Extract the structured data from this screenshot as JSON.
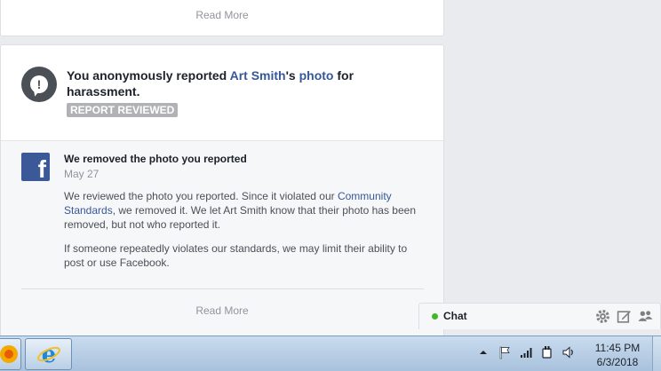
{
  "top_card": {
    "read_more": "Read More"
  },
  "report": {
    "prefix": "You anonymously reported ",
    "person": "Art Smith",
    "possessive": "'s ",
    "object": "photo",
    "suffix": " for harassment.",
    "badge": "REPORT REVIEWED"
  },
  "message": {
    "title": "We removed the photo you reported",
    "date": "May 27",
    "p1_before": "We reviewed the photo you reported. Since it violated our ",
    "p1_link": "Community Standards",
    "p1_after": ", we removed it. We let Art Smith know that their photo has been removed, but not who reported it.",
    "p2": "If someone repeatedly violates our standards, we may limit their ability to post or use Facebook.",
    "read_more": "Read More"
  },
  "chat": {
    "label": "Chat",
    "icons": [
      "gear-icon",
      "compose-icon",
      "friends-icon"
    ],
    "status_color": "#42b72a"
  },
  "taskbar": {
    "time": "11:45 PM",
    "date": "6/3/2018",
    "tray_icons": [
      "up-arrow-icon",
      "flag-icon",
      "signal-icon",
      "power-icon",
      "volume-icon"
    ]
  },
  "colors": {
    "link": "#365899",
    "fb_blue": "#3b5998",
    "badge": "#b0b2b6"
  }
}
